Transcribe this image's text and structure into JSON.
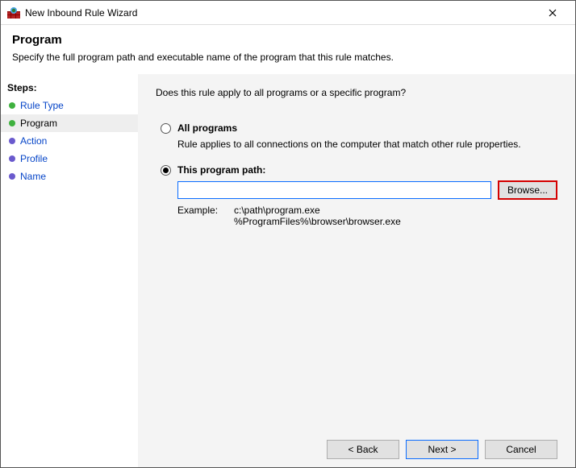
{
  "titlebar": {
    "title": "New Inbound Rule Wizard"
  },
  "header": {
    "title": "Program",
    "subtitle": "Specify the full program path and executable name of the program that this rule matches."
  },
  "sidebar": {
    "header": "Steps:",
    "items": [
      {
        "label": "Rule Type"
      },
      {
        "label": "Program"
      },
      {
        "label": "Action"
      },
      {
        "label": "Profile"
      },
      {
        "label": "Name"
      }
    ]
  },
  "main": {
    "question": "Does this rule apply to all programs or a specific program?",
    "options": {
      "all": {
        "label": "All programs",
        "desc": "Rule applies to all connections on the computer that match other rule properties."
      },
      "path": {
        "label": "This program path:",
        "value": "",
        "browse": "Browse...",
        "example_label": "Example:",
        "example_text": "c:\\path\\program.exe\n%ProgramFiles%\\browser\\browser.exe"
      }
    }
  },
  "footer": {
    "back": "< Back",
    "next": "Next >",
    "cancel": "Cancel"
  }
}
